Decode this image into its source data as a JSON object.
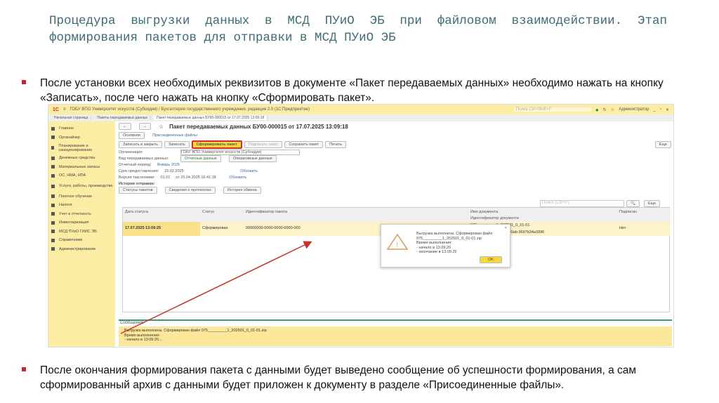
{
  "slide": {
    "title": "Процедура выгрузки данных в МСД ПУиО ЭБ при файловом взаимодействии. Этап формирования пакетов для отправки в МСД ПУиО ЭБ",
    "bullet1": "После установки всех необходимых реквизитов в документе «Пакет передаваемых данных» необходимо нажать на кнопку «Записать», после чего нажать на кнопку «Сформировать пакет».",
    "bullet2": "После окончания формирования пакета с данными будет выведено сообщение об успешности формирования, а сам сформированный архив с данными будет приложен к документу в разделе «Присоединенные файлы»."
  },
  "app": {
    "logo": "1С",
    "window_title": "ГОБУ ВПО Университет искусств (Субсидия) / Бухгалтерия государственного учреждения, редакция 2.0 (1С:Предприятие)",
    "search_placeholder": "Поиск Ctrl+Shift+F",
    "user": "Администратор",
    "tabs": [
      "Начальная страница",
      "Пакеты передаваемых данных",
      "Пакет передаваемых данных БУ00-000015 от 17.07.2025 13:09:18"
    ],
    "sidebar": [
      "Главное",
      "Органайзер",
      "Планирование и санкционирование",
      "Денежные средства",
      "Материальные запасы",
      "ОС, НМА, НПА",
      "Услуги, работы, производство",
      "Платное обучение",
      "Налоги",
      "Учет и отчетность",
      "Инвентаризация",
      "МСД ПУиО ГИИС ЭБ",
      "Справочники",
      "Администрирование"
    ],
    "doc_title": "Пакет передаваемых данных БУ00-000015 от 17.07.2025 13:09:18",
    "subtabs": [
      "Основное",
      "Присоединенные файлы"
    ],
    "buttons": {
      "save_close": "Записать и закрыть",
      "save": "Записать",
      "form_package": "Сформировать пакет",
      "sign": "Подписать пакет",
      "save_package": "Сохранить пакет",
      "print": "Печать",
      "more": "Еще"
    },
    "org_label": "Организация:",
    "org_value": "ГОБУ ВПО Университет искусств (Субсидия)",
    "kind_label": "Вид передаваемых данных:",
    "kind_options": [
      "Отчетные данные",
      "Оперативные данные"
    ],
    "period_label": "Отчетный период:",
    "period_value": "Январь 2025",
    "deadline_label": "Срок предоставления:",
    "deadline_value": "15.02.2025",
    "refresh": "Обновить",
    "taxonomy_label": "Версия таксономии:",
    "taxonomy_value": "01.01",
    "taxonomy_date": "от 25.04.2025 16:41:18",
    "history_label": "История отправки:",
    "history_tabs": [
      "Статусы пакетов",
      "Сведения о протоколах",
      "История обмена"
    ],
    "grid_search": "Поиск (Ctrl+F)",
    "columns": [
      "Дата статуса",
      "Статус",
      "Идентификатор пакета",
      "Имя документа",
      "Идентификатор документа",
      "Подписан"
    ],
    "row": {
      "date": "17.07.2025 13:09:25",
      "status": "Сформирован",
      "package_id": "00000000-0000-0000-0000-000",
      "doc_name": "075_________1_202501_0_01-01",
      "doc_id": "09baea66-19e4-4e56-90ab-3697b34a3396",
      "signed": "Нет"
    },
    "dialog": {
      "text": "Выгрузка выполнена. Сформирован файл 075_________1_202501_0_01-01.zip",
      "time_label": "Время выполнения:",
      "start": "- начало в      13.09.20",
      "end": "- окончание в 13.09.25",
      "ok": "OK"
    },
    "messages_label": "Сообщения:",
    "message": {
      "text": "Выгрузка выполнена. Сформирован файл 075_________1_202501_0_01-01.zip",
      "time_label": "Время выполнения:",
      "start": "- начало в      13:09:20..."
    }
  },
  "colors": {
    "accent": "#fbeda4",
    "highlight": "#d42b2b",
    "title": "#3d6b73"
  }
}
